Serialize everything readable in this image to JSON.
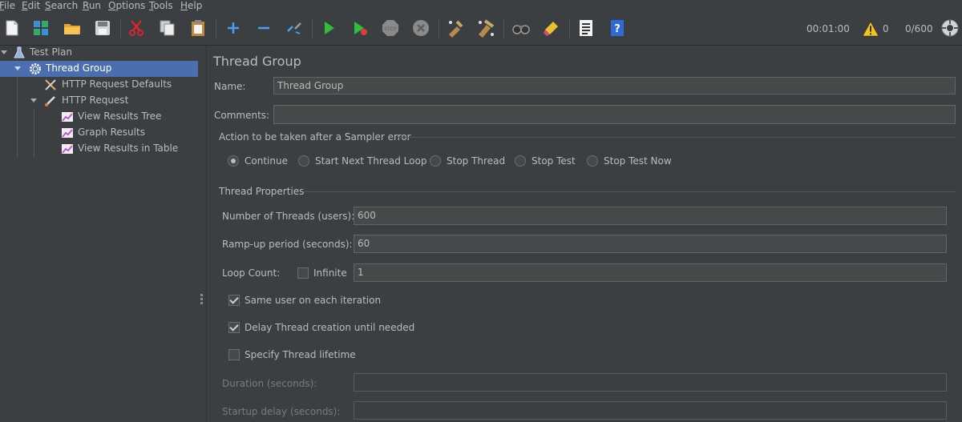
{
  "menu": [
    "File",
    "Edit",
    "Search",
    "Run",
    "Options",
    "Tools",
    "Help"
  ],
  "toolbar": {
    "icons": [
      "new-icon",
      "templates-icon",
      "open-icon",
      "save-icon",
      "cut-icon",
      "copy-icon",
      "paste-icon",
      "expand-icon",
      "collapse-icon",
      "toggle-icon",
      "start-icon",
      "start-no-timers-icon",
      "stop-icon",
      "shutdown-icon",
      "clear-icon",
      "clear-all-icon",
      "search-icon",
      "reset-search-icon",
      "function-helper-icon",
      "help-icon"
    ],
    "elapsed": "00:01:00",
    "warnings": "0",
    "threads": "0/600"
  },
  "tree": [
    {
      "label": "Test Plan",
      "icon": "test-plan-icon"
    },
    {
      "label": "Thread Group",
      "icon": "thread-group-gear-icon",
      "selected": true
    },
    {
      "label": "HTTP Request Defaults",
      "icon": "config-tools-icon"
    },
    {
      "label": "HTTP Request",
      "icon": "sampler-pipette-icon"
    },
    {
      "label": "View Results Tree",
      "icon": "listener-graph-icon"
    },
    {
      "label": "Graph Results",
      "icon": "listener-graph-icon"
    },
    {
      "label": "View Results in Table",
      "icon": "listener-graph-icon"
    }
  ],
  "panel": {
    "title": "Thread Group",
    "name_label": "Name:",
    "name_value": "Thread Group",
    "comments_label": "Comments:",
    "comments_value": "",
    "error_action_title": "Action to be taken after a Sampler error",
    "error_actions": [
      "Continue",
      "Start Next Thread Loop",
      "Stop Thread",
      "Stop Test",
      "Stop Test Now"
    ],
    "error_action_selected": "Continue",
    "thread_props_title": "Thread Properties",
    "threads_label": "Number of Threads (users):",
    "threads_value": "600",
    "rampup_label": "Ramp-up period (seconds):",
    "rampup_value": "60",
    "loop_label": "Loop Count:",
    "infinite_label": "Infinite",
    "infinite_checked": false,
    "loop_value": "1",
    "same_user_label": "Same user on each iteration",
    "same_user_checked": true,
    "delay_label": "Delay Thread creation until needed",
    "delay_checked": true,
    "lifetime_label": "Specify Thread lifetime",
    "lifetime_checked": false,
    "duration_label": "Duration (seconds):",
    "duration_value": "",
    "startup_label": "Startup delay (seconds):",
    "startup_value": ""
  }
}
